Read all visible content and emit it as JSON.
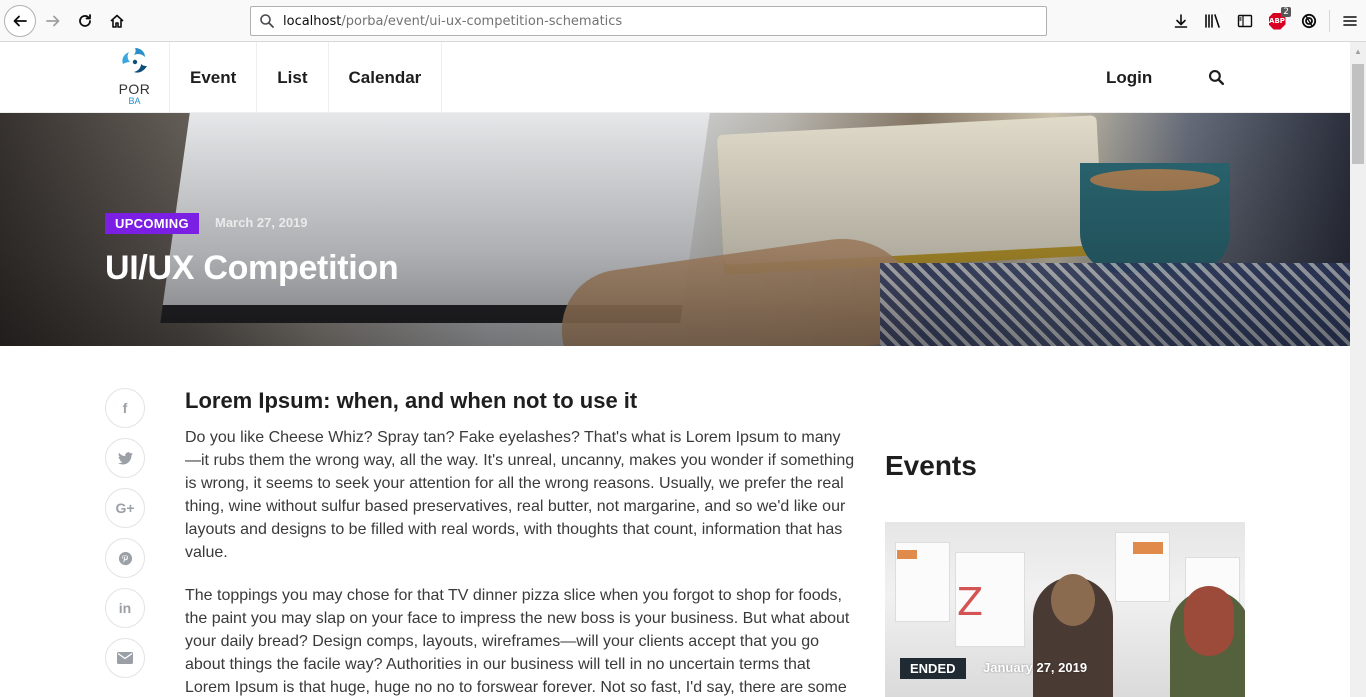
{
  "browser": {
    "url_host": "localhost",
    "url_path": "/porba/event/ui-ux-competition-schematics",
    "abp_count": "2",
    "abp_label": "ABP"
  },
  "header": {
    "logo_top": "POR",
    "logo_bottom": "BA",
    "nav": [
      {
        "label": "Event"
      },
      {
        "label": "List"
      },
      {
        "label": "Calendar"
      }
    ],
    "login_label": "Login"
  },
  "hero": {
    "badge": "UPCOMING",
    "date": "March 27, 2019",
    "title": "UI/UX Competition",
    "badge_color": "#7b1fe4"
  },
  "social": [
    {
      "icon": "facebook-icon",
      "glyph": "f"
    },
    {
      "icon": "twitter-icon",
      "glyph": "t"
    },
    {
      "icon": "google-plus-icon",
      "glyph": "G+"
    },
    {
      "icon": "pinterest-icon",
      "glyph": "p"
    },
    {
      "icon": "linkedin-icon",
      "glyph": "in"
    },
    {
      "icon": "email-icon",
      "glyph": "✉"
    }
  ],
  "article": {
    "heading": "Lorem Ipsum: when, and when not to use it",
    "p1": "Do you like Cheese Whiz? Spray tan? Fake eyelashes? That's what is Lorem Ipsum to many—it rubs them the wrong way, all the way. It's unreal, uncanny, makes you wonder if something is wrong, it seems to seek your attention for all the wrong reasons. Usually, we prefer the real thing, wine without sulfur based preservatives, real butter, not margarine, and so we'd like our layouts and designs to be filled with real words, with thoughts that count, information that has value.",
    "p2": "The toppings you may chose for that TV dinner pizza slice when you forgot to shop for foods, the paint you may slap on your face to impress the new boss is your business. But what about your daily bread? Design comps, layouts, wireframes—will your clients accept that you go about things the facile way? Authorities in our business will tell in no uncertain terms that Lorem Ipsum is that huge, huge no no to forswear forever. Not so fast, I'd say, there are some"
  },
  "sidebar": {
    "title": "Events",
    "event_badge": "ENDED",
    "event_date": "January 27, 2019",
    "event_badge_color": "#1f2a33"
  }
}
